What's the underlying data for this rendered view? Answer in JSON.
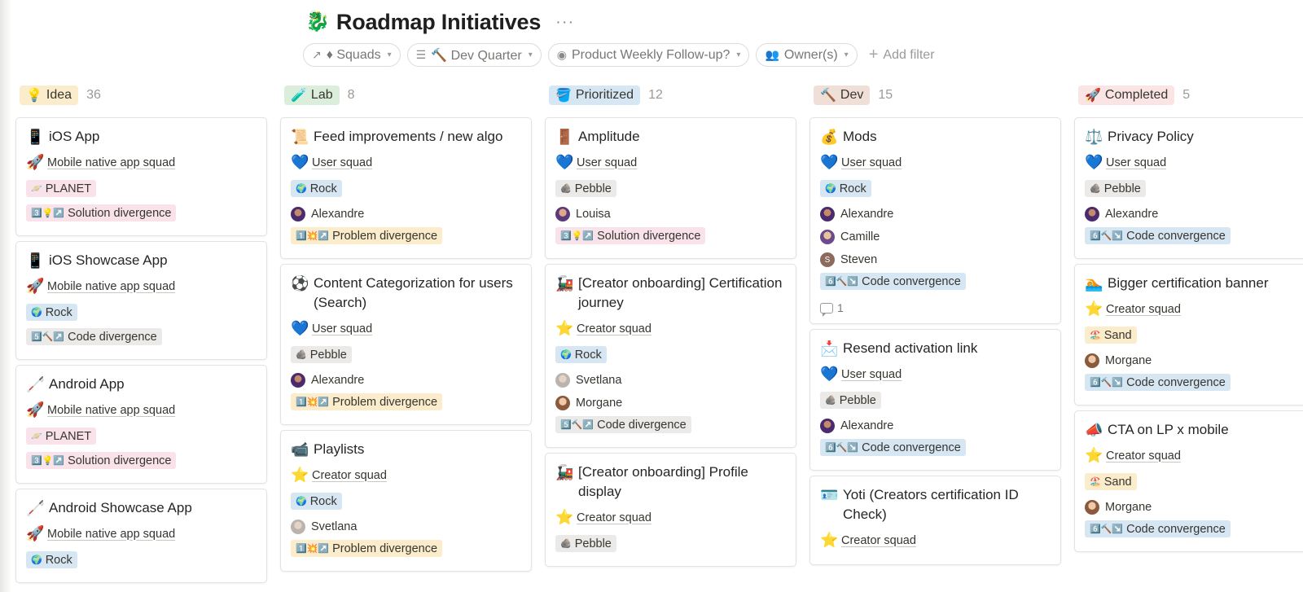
{
  "page": {
    "title_icon": "🐉",
    "title": "Roadmap Initiatives",
    "more": "···"
  },
  "filters": [
    {
      "icon": "↗",
      "label": "♦ Squads"
    },
    {
      "icon": "☰",
      "label": "🔨 Dev Quarter"
    },
    {
      "icon": "◉",
      "label": "Product Weekly Follow-up?"
    },
    {
      "icon": "👥",
      "label": "Owner(s)"
    }
  ],
  "add_filter": "Add filter",
  "columns": [
    {
      "emoji": "💡",
      "label": "Idea",
      "count": "36",
      "color": "#fbeccb",
      "cards": [
        {
          "emoji": "📱",
          "title": "iOS App",
          "squad_emoji": "🚀",
          "squad": "Mobile native app squad",
          "tags": [
            {
              "emoji": "🪐",
              "text": "PLANET",
              "bg": "pink"
            },
            {
              "emoji": "3️⃣💡↗️",
              "text": "Solution divergence",
              "bg": "pink"
            }
          ],
          "owners": []
        },
        {
          "emoji": "📱",
          "title": "iOS Showcase App",
          "squad_emoji": "🚀",
          "squad": "Mobile native app squad",
          "tags": [
            {
              "emoji": "🌍",
              "text": "Rock",
              "bg": "blue"
            },
            {
              "emoji": "5️⃣🔨↗️",
              "text": "Code divergence",
              "bg": "gray"
            }
          ],
          "owners": []
        },
        {
          "emoji": "🦯",
          "title": "Android App",
          "squad_emoji": "🚀",
          "squad": "Mobile native app squad",
          "tags": [
            {
              "emoji": "🪐",
              "text": "PLANET",
              "bg": "pink"
            },
            {
              "emoji": "3️⃣💡↗️",
              "text": "Solution divergence",
              "bg": "pink"
            }
          ],
          "owners": []
        },
        {
          "emoji": "🦯",
          "title": "Android Showcase App",
          "squad_emoji": "🚀",
          "squad": "Mobile native app squad",
          "tags": [
            {
              "emoji": "🌍",
              "text": "Rock",
              "bg": "blue"
            }
          ],
          "owners": []
        }
      ]
    },
    {
      "emoji": "🧪",
      "label": "Lab",
      "count": "8",
      "color": "#dbeddb",
      "cards": [
        {
          "emoji": "📜",
          "title": "Feed improvements / new algo",
          "squad_emoji": "💙",
          "squad": "User squad",
          "tags": [
            {
              "emoji": "🌍",
              "text": "Rock",
              "bg": "blue"
            }
          ],
          "owners": [
            {
              "name": "Alexandre",
              "av": "alex"
            }
          ],
          "tags2": [
            {
              "emoji": "1️⃣💥↗️",
              "text": "Problem divergence",
              "bg": "yellow"
            }
          ]
        },
        {
          "emoji": "⚽",
          "title": "Content Categorization for users (Search)",
          "squad_emoji": "💙",
          "squad": "User squad",
          "tags": [
            {
              "emoji": "🪨",
              "text": "Pebble",
              "bg": "gray"
            }
          ],
          "owners": [
            {
              "name": "Alexandre",
              "av": "alex"
            }
          ],
          "tags2": [
            {
              "emoji": "1️⃣💥↗️",
              "text": "Problem divergence",
              "bg": "yellow"
            }
          ]
        },
        {
          "emoji": "📹",
          "title": "Playlists",
          "squad_emoji": "⭐",
          "squad": "Creator squad",
          "tags": [
            {
              "emoji": "🌍",
              "text": "Rock",
              "bg": "blue"
            }
          ],
          "owners": [
            {
              "name": "Svetlana",
              "av": "svetlana"
            }
          ],
          "tags2": [
            {
              "emoji": "1️⃣💥↗️",
              "text": "Problem divergence",
              "bg": "yellow"
            }
          ]
        }
      ]
    },
    {
      "emoji": "🪣",
      "label": "Prioritized",
      "count": "12",
      "color": "#d6e6f3",
      "cards": [
        {
          "emoji": "🚪",
          "title": "Amplitude",
          "squad_emoji": "💙",
          "squad": "User squad",
          "tags": [
            {
              "emoji": "🪨",
              "text": "Pebble",
              "bg": "gray"
            }
          ],
          "owners": [
            {
              "name": "Louisa",
              "av": "louisa"
            }
          ],
          "tags2": [
            {
              "emoji": "3️⃣💡↗️",
              "text": "Solution divergence",
              "bg": "pink"
            }
          ]
        },
        {
          "emoji": "🚂",
          "title": "[Creator onboarding] Certification journey",
          "squad_emoji": "⭐",
          "squad": "Creator squad",
          "tags": [
            {
              "emoji": "🌍",
              "text": "Rock",
              "bg": "blue"
            }
          ],
          "owners": [
            {
              "name": "Svetlana",
              "av": "svetlana"
            },
            {
              "name": "Morgane",
              "av": "morgane"
            }
          ],
          "tags2": [
            {
              "emoji": "5️⃣🔨↗️",
              "text": "Code divergence",
              "bg": "gray"
            }
          ]
        },
        {
          "emoji": "🚂",
          "title": "[Creator onboarding] Profile display",
          "squad_emoji": "⭐",
          "squad": "Creator squad",
          "tags": [
            {
              "emoji": "🪨",
              "text": "Pebble",
              "bg": "gray"
            }
          ],
          "owners": []
        }
      ]
    },
    {
      "emoji": "🔨",
      "label": "Dev",
      "count": "15",
      "color": "#f0dfd6",
      "cards": [
        {
          "emoji": "💰",
          "title": "Mods",
          "squad_emoji": "💙",
          "squad": "User squad",
          "tags": [
            {
              "emoji": "🌍",
              "text": "Rock",
              "bg": "blue"
            }
          ],
          "owners": [
            {
              "name": "Alexandre",
              "av": "alex"
            },
            {
              "name": "Camille",
              "av": "camille"
            },
            {
              "name": "Steven",
              "av": "steven"
            }
          ],
          "tags2": [
            {
              "emoji": "6️⃣🔨↘️",
              "text": "Code convergence",
              "bg": "blue"
            }
          ],
          "comments": "1"
        },
        {
          "emoji": "📩",
          "title": "Resend activation link",
          "squad_emoji": "💙",
          "squad": "User squad",
          "tags": [
            {
              "emoji": "🪨",
              "text": "Pebble",
              "bg": "gray"
            }
          ],
          "owners": [
            {
              "name": "Alexandre",
              "av": "alex"
            }
          ],
          "tags2": [
            {
              "emoji": "6️⃣🔨↘️",
              "text": "Code convergence",
              "bg": "blue"
            }
          ]
        },
        {
          "emoji": "🪪",
          "title": "Yoti (Creators certification ID Check)",
          "squad_emoji": "⭐",
          "squad": "Creator squad",
          "tags": [],
          "owners": []
        }
      ]
    },
    {
      "emoji": "🚀",
      "label": "Completed",
      "count": "5",
      "color": "#fbe4e4",
      "cards": [
        {
          "emoji": "⚖️",
          "title": "Privacy Policy",
          "squad_emoji": "💙",
          "squad": "User squad",
          "tags": [
            {
              "emoji": "🪨",
              "text": "Pebble",
              "bg": "gray"
            }
          ],
          "owners": [
            {
              "name": "Alexandre",
              "av": "alex"
            }
          ],
          "tags2": [
            {
              "emoji": "6️⃣🔨↘️",
              "text": "Code convergence",
              "bg": "blue"
            }
          ]
        },
        {
          "emoji": "🏊",
          "title": "Bigger certification banner",
          "squad_emoji": "⭐",
          "squad": "Creator squad",
          "tags": [
            {
              "emoji": "🏖️",
              "text": "Sand",
              "bg": "yellow"
            }
          ],
          "owners": [
            {
              "name": "Morgane",
              "av": "morgane"
            }
          ],
          "tags2": [
            {
              "emoji": "6️⃣🔨↘️",
              "text": "Code convergence",
              "bg": "blue"
            }
          ]
        },
        {
          "emoji": "📣",
          "title": "CTA on LP x mobile",
          "squad_emoji": "⭐",
          "squad": "Creator squad",
          "tags": [
            {
              "emoji": "🏖️",
              "text": "Sand",
              "bg": "yellow"
            }
          ],
          "owners": [
            {
              "name": "Morgane",
              "av": "morgane"
            }
          ],
          "tags2": [
            {
              "emoji": "6️⃣🔨↘️",
              "text": "Code convergence",
              "bg": "blue"
            }
          ]
        }
      ]
    }
  ]
}
